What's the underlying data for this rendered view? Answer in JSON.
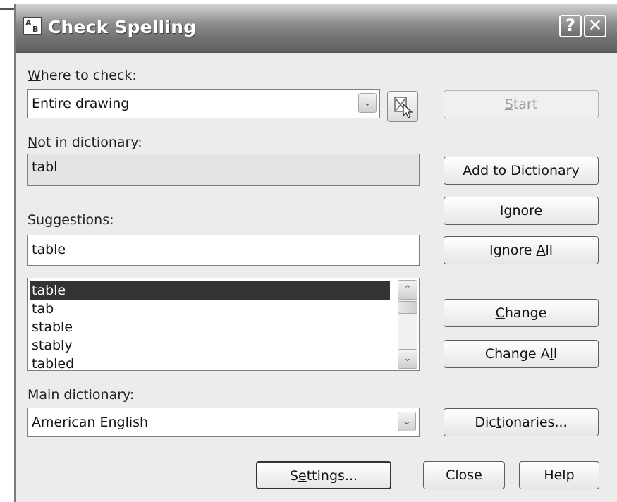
{
  "window": {
    "title": "Check Spelling",
    "help_glyph": "?",
    "close_glyph": "✕"
  },
  "where": {
    "label": "Where to check:",
    "value": "Entire drawing"
  },
  "not_in_dictionary": {
    "label": "Not in dictionary:",
    "value": "tabl"
  },
  "suggestions": {
    "label": "Suggestions:",
    "value": "table",
    "items": [
      "table",
      "tab",
      "stable",
      "stably",
      "tabled"
    ],
    "selected_index": 0
  },
  "main_dictionary": {
    "label": "Main dictionary:",
    "value": "American English"
  },
  "buttons": {
    "start": "Start",
    "add_to_dictionary": "Add to Dictionary",
    "ignore": "Ignore",
    "ignore_all": "Ignore All",
    "change": "Change",
    "change_all": "Change All",
    "dictionaries": "Dictionaries...",
    "settings": "Settings...",
    "close": "Close",
    "help": "Help"
  },
  "icons": {
    "app": "check-spelling-icon",
    "select_objects": "select-objects-icon",
    "dropdown": "chevron-down-icon",
    "scroll_up": "chevron-up-icon",
    "scroll_down": "chevron-down-icon"
  }
}
